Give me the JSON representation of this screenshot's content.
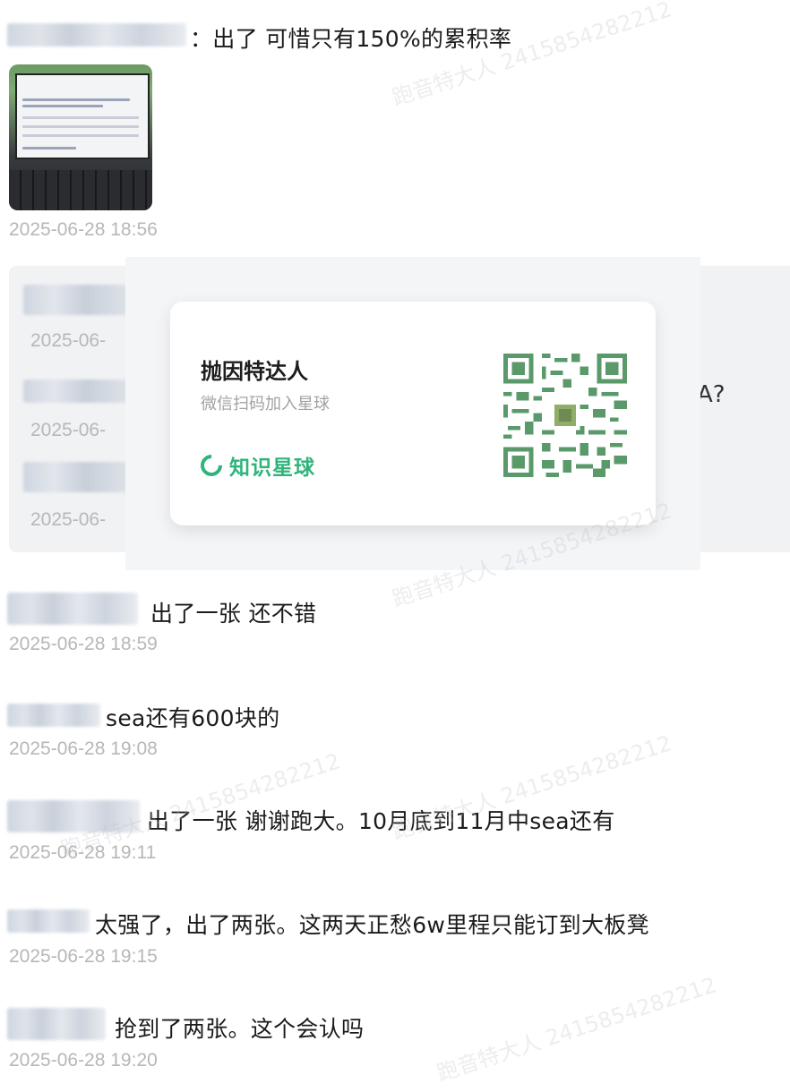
{
  "messages": [
    {
      "text": "：出了 可惜只有150%的累积率",
      "time": "2025-06-28 18:56"
    },
    {
      "text": "出了一张 还不错",
      "time": "2025-06-28 18:59"
    },
    {
      "text": "sea还有600块的",
      "time": "2025-06-28 19:08"
    },
    {
      "text": "出了一张 谢谢跑大。10月底到11月中sea还有",
      "time": "2025-06-28 19:11"
    },
    {
      "text": "太强了，出了两张。这两天正愁6w里程只能订到大板凳",
      "time": "2025-06-28 19:15"
    },
    {
      "text": "抢到了两张。这个会认吗",
      "time": "2025-06-28 19:20"
    }
  ],
  "hidden_times": [
    "2025-06-",
    "2025-06-",
    "2025-06-"
  ],
  "hidden_tail": "A?",
  "card": {
    "title": "抛因特达人",
    "subtitle": "微信扫码加入星球",
    "brand": "知识星球",
    "brand_color": "#2fb47c",
    "qr_color": "#5a9a6a"
  },
  "watermark": "跑音特大人 2415854282212"
}
